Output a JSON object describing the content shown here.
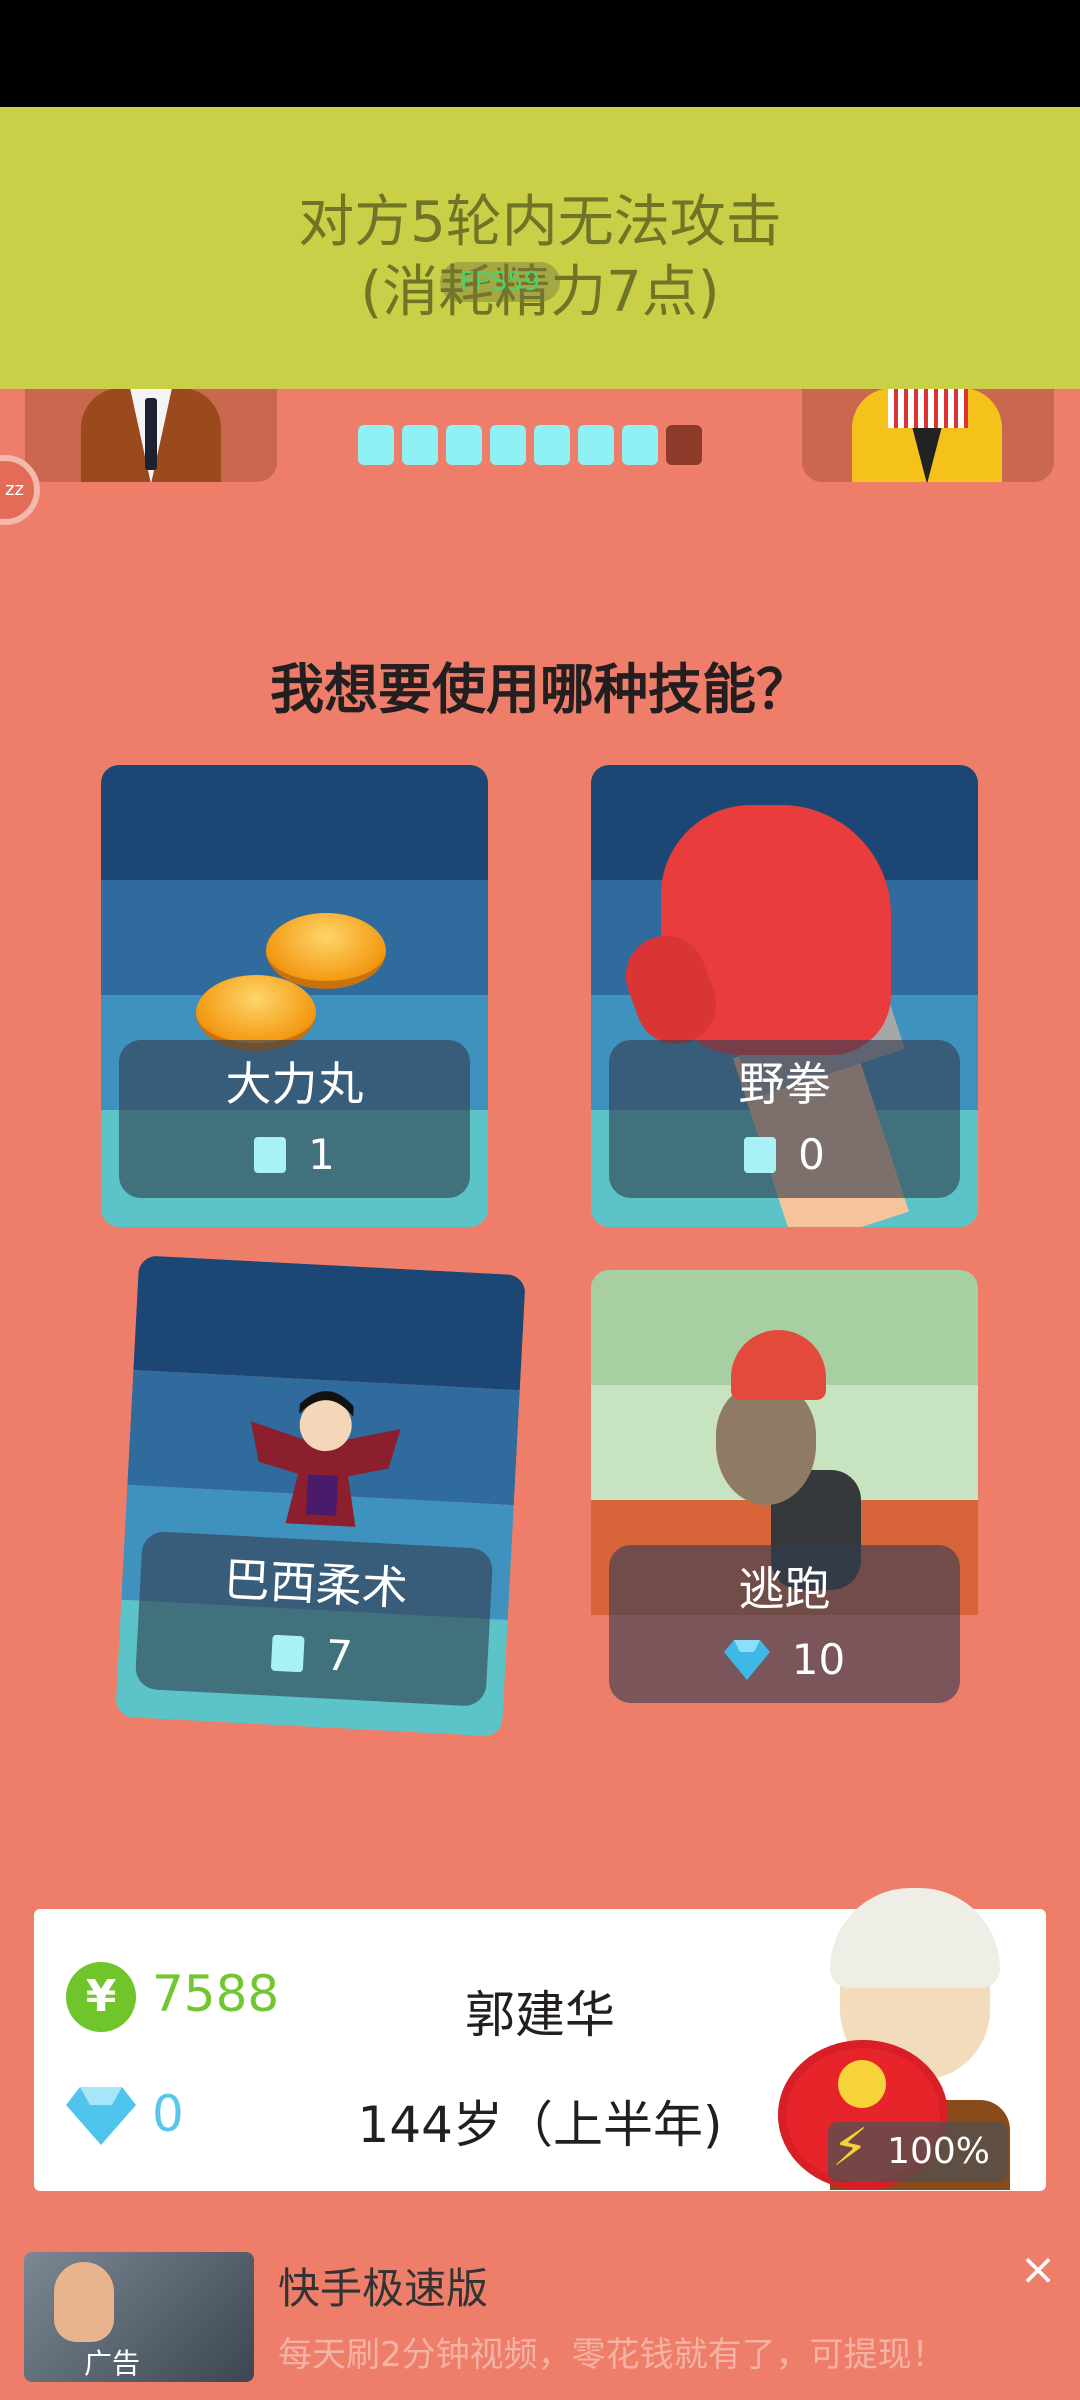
{
  "banner": {
    "line1": "对方5轮内无法攻击",
    "line2": "(消耗精力7点)",
    "fps": "FPS59"
  },
  "hud": {
    "rounds_total": 8,
    "rounds_done": 7,
    "left_bubble": "zz"
  },
  "question": "我想要使用哪种技能？",
  "cards": [
    {
      "name": "大力丸",
      "cost": "1",
      "currency": "square-icon"
    },
    {
      "name": "野拳",
      "cost": "0",
      "currency": "square-icon"
    },
    {
      "name": "巴西柔术",
      "cost": "7",
      "currency": "square-icon"
    },
    {
      "name": "逃跑",
      "cost": "10",
      "currency": "diamond-icon"
    }
  ],
  "player": {
    "coins": "7588",
    "gems": "0",
    "name": "郭建华",
    "age": "144岁（上半年)",
    "energy": "100%",
    "yen_symbol": "¥"
  },
  "ad": {
    "title": "快手极速版",
    "desc": "每天刷2分钟视频，零花钱就有了，可提现！",
    "badge": "广告",
    "close": "×"
  },
  "colors": {
    "background": "#ee7e69",
    "banner": "#c9d048",
    "coins_green": "#73c631",
    "gems_blue": "#58c7ea"
  }
}
